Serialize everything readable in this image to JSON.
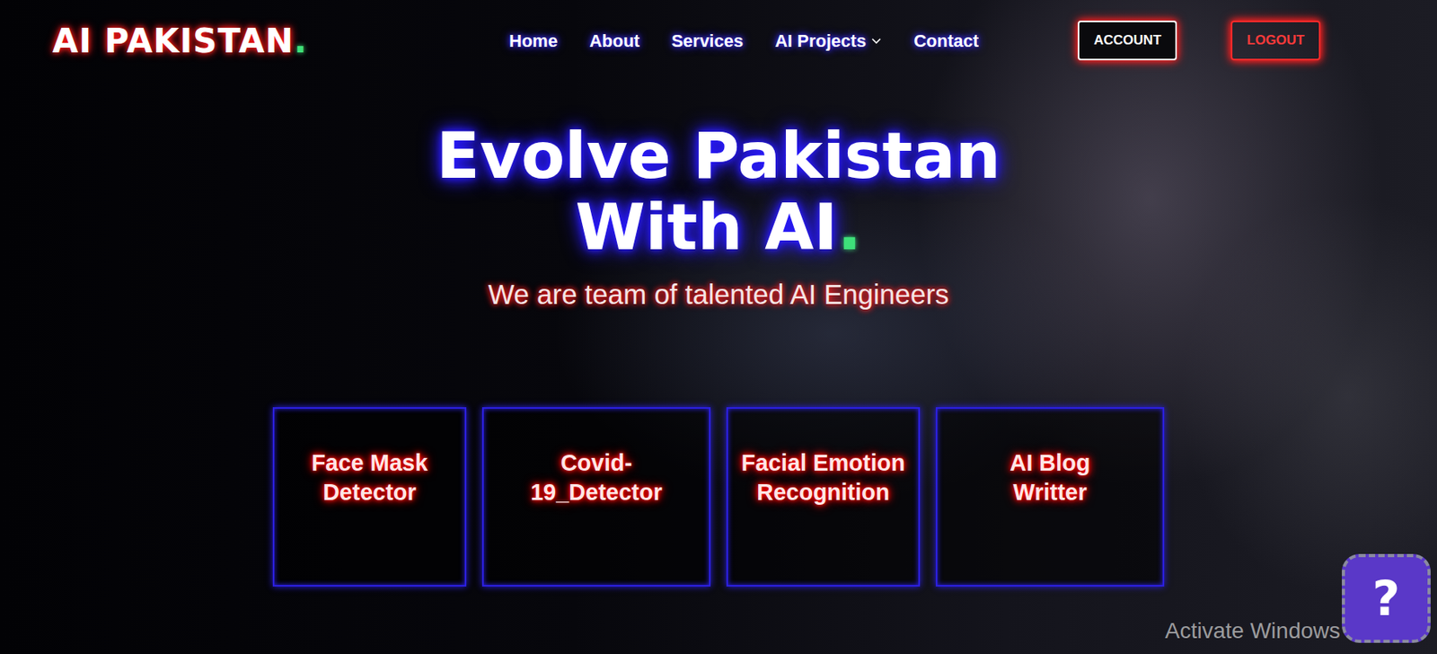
{
  "header": {
    "logo": "AI PAKISTAN",
    "logo_dot": ".",
    "nav": [
      {
        "label": "Home",
        "kind": "link"
      },
      {
        "label": "About",
        "kind": "link"
      },
      {
        "label": "Services",
        "kind": "link"
      },
      {
        "label": "AI Projects",
        "kind": "dropdown"
      },
      {
        "label": "Contact",
        "kind": "link"
      }
    ],
    "buttons": [
      "ACCOUNT",
      "LOGOUT"
    ]
  },
  "hero": {
    "title_lines": [
      "Evolve Pakistan",
      "With AI"
    ],
    "title_dot": ".",
    "subtitle": "We are team of talented AI Engineers"
  },
  "projects": [
    "Face Mask Detector",
    "Covid-19_Detector",
    "Facial Emotion Recognition",
    "AI Blog Writter"
  ],
  "help": "?",
  "watermark": "Activate Windows"
}
